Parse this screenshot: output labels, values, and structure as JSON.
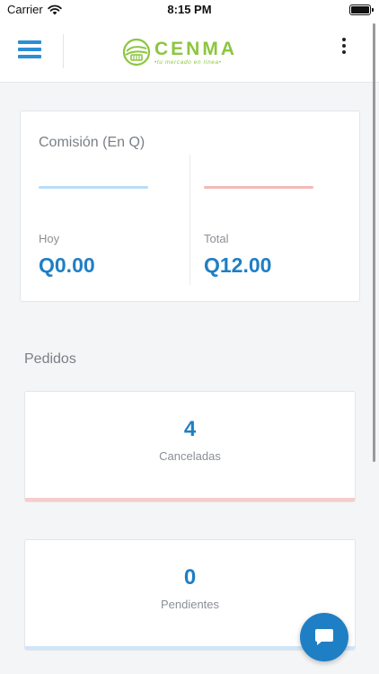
{
  "status_bar": {
    "carrier": "Carrier",
    "time": "8:15 PM"
  },
  "header": {
    "logo_name": "CENMA",
    "logo_tagline": "•tu mercado en línea•",
    "brand_color": "#8cc63f",
    "accent_color": "#2a8fd6",
    "icons": [
      "hamburger-menu-icon",
      "cenma-logo",
      "more-vertical-icon"
    ]
  },
  "commission": {
    "title": "Comisión (En Q)",
    "today": {
      "label": "Hoy",
      "value": "Q0.00",
      "color": "#b9dcf7"
    },
    "total": {
      "label": "Total",
      "value": "Q12.00",
      "color": "#f4b9b9"
    }
  },
  "orders": {
    "title": "Pedidos",
    "stats": [
      {
        "value": "4",
        "label": "Canceladas",
        "color": "#f6cccc"
      },
      {
        "value": "0",
        "label": "Pendientes",
        "color": "#cfe6fa"
      }
    ]
  },
  "chat": {
    "icon": "chat-bubble-icon",
    "color": "#1f7fc4"
  }
}
